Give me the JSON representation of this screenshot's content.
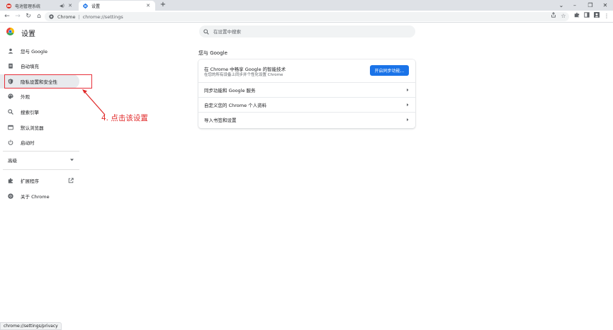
{
  "tabs": [
    {
      "title": "电池管理系统",
      "active": false
    },
    {
      "title": "设置",
      "active": true
    }
  ],
  "new_tab_symbol": "+",
  "window_controls": {
    "dropdown": "⌄",
    "minimize": "–",
    "restore": "❐",
    "close": "✕"
  },
  "toolbar": {
    "back_symbol": "←",
    "forward_symbol": "→",
    "reload_symbol": "↻",
    "home_symbol": "⌂",
    "site_label": "Chrome",
    "separator": "|",
    "url": "chrome://settings"
  },
  "settings": {
    "title": "设置",
    "search_placeholder": "在设置中搜索"
  },
  "sidebar": {
    "items": [
      {
        "label": "您与 Google",
        "icon": "person-icon"
      },
      {
        "label": "自动填充",
        "icon": "clipboard-icon"
      },
      {
        "label": "隐私设置和安全性",
        "icon": "shield-icon",
        "active": true
      },
      {
        "label": "外观",
        "icon": "palette-icon"
      },
      {
        "label": "搜索引擎",
        "icon": "search-icon"
      },
      {
        "label": "默认浏览器",
        "icon": "browser-icon"
      },
      {
        "label": "启动时",
        "icon": "power-icon"
      }
    ],
    "advanced_label": "高级",
    "extensions_label": "扩展程序",
    "about_label": "关于 Chrome"
  },
  "annotation": {
    "text": "4. 点击该设置",
    "color": "#e02828"
  },
  "main": {
    "section_heading": "您与 Google",
    "sync_title": "在 Chrome 中畅享 Google 的智能技术",
    "sync_subtitle": "在您的所有设备上同步并个性化设置 Chrome",
    "sync_button": "开启同步功能...",
    "rows": [
      {
        "label": "同步功能和 Google 服务"
      },
      {
        "label": "自定义您的 Chrome 个人资料"
      },
      {
        "label": "导入书签和设置"
      }
    ]
  },
  "status_bar": {
    "text": "chrome://settings/privacy"
  },
  "colors": {
    "accent": "#1a73e8",
    "highlight": "#e8303a",
    "annotation": "#e02828"
  }
}
